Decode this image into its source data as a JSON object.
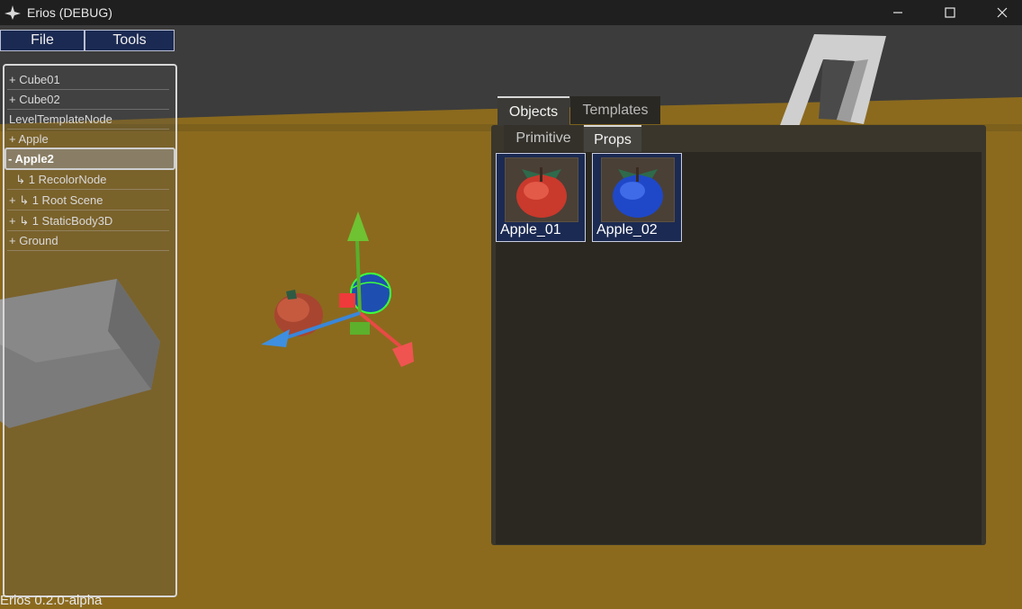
{
  "window": {
    "title": "Erios (DEBUG)",
    "minimize_icon": "minimize-icon",
    "maximize_icon": "maximize-icon",
    "close_icon": "close-icon"
  },
  "menu": {
    "file": "File",
    "tools": "Tools"
  },
  "tree": {
    "items": [
      {
        "label": "+ Cube01"
      },
      {
        "label": "+ Cube02"
      },
      {
        "label": "LevelTemplateNode"
      },
      {
        "label": "+ Apple"
      },
      {
        "label": "- Apple2",
        "selected": true
      },
      {
        "label": "  ↳ 1 RecolorNode"
      },
      {
        "label": "+ ↳ 1 Root Scene"
      },
      {
        "label": "+ ↳ 1 StaticBody3D"
      },
      {
        "label": "+ Ground"
      }
    ]
  },
  "assets": {
    "tabs": [
      "Objects",
      "Templates"
    ],
    "subtabs": [
      "Primitive",
      "Props"
    ],
    "items": [
      {
        "label": "Apple_01",
        "color": "#c9392c"
      },
      {
        "label": "Apple_02",
        "color": "#1f48c8"
      }
    ]
  },
  "version": "Erios 0.2.0-alpha",
  "colors": {
    "menu_bg": "#1b2a52",
    "ground": "#8a6a1c",
    "sky": "#3d3d3d"
  }
}
